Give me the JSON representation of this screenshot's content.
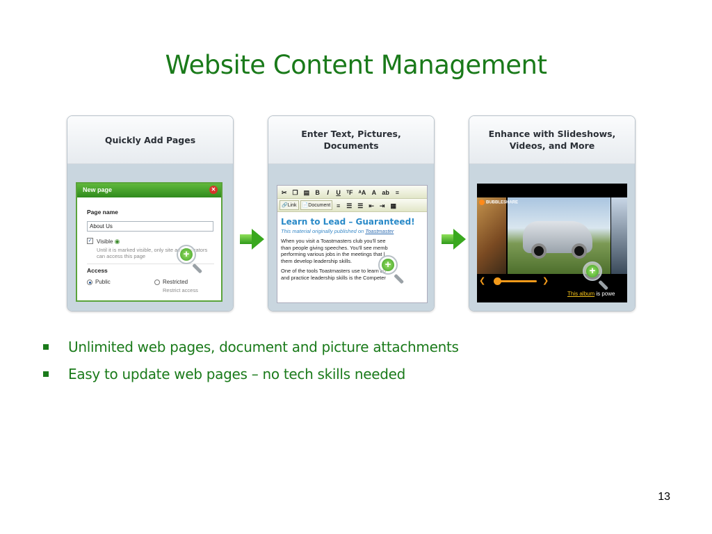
{
  "slide": {
    "title": "Website Content Management",
    "page_number": "13"
  },
  "cards": [
    {
      "heading": "Quickly Add Pages"
    },
    {
      "heading": "Enter Text, Pictures, Documents"
    },
    {
      "heading": "Enhance with Slideshows, Videos, and More"
    }
  ],
  "new_page_dialog": {
    "title": "New page",
    "page_name_label": "Page name",
    "page_name_value": "About Us",
    "visible_label": "Visible",
    "visible_checked": true,
    "visible_help": "Until it is marked visible, only site administrators can access this page",
    "access_label": "Access",
    "option_public": "Public",
    "option_restricted": "Restricted",
    "restricted_help": "Restrict access",
    "selected_access": "Public"
  },
  "editor": {
    "link_button": "Link",
    "document_button": "Document",
    "heading": "Learn to Lead – Guaranteed!",
    "byline_prefix": "This material originally published on",
    "byline_link": "Toastmaster",
    "para1_line1": "When you visit a Toastmasters club you'll see",
    "para1_line2": "than people giving speeches. You'll see memb",
    "para1_line3": "performing various jobs in the meetings that l",
    "para1_line4": "them develop leadership skills.",
    "para2_line1": "One of the tools Toastmasters use to learn ab",
    "para2_line2": "and practice leadership skills is the Competer"
  },
  "slideshow": {
    "brand": "BUBBLESHARE",
    "album_link": "This album",
    "album_suffix": "is powe"
  },
  "bullets": [
    "Unlimited web pages, document and picture attachments",
    "Easy to update web pages – no tech skills needed"
  ],
  "colors": {
    "title_green": "#1a7a1a",
    "dialog_green": "#2f8a1d",
    "editor_heading_blue": "#2a8ac8",
    "slideshow_accent_orange": "#f39a1a"
  }
}
